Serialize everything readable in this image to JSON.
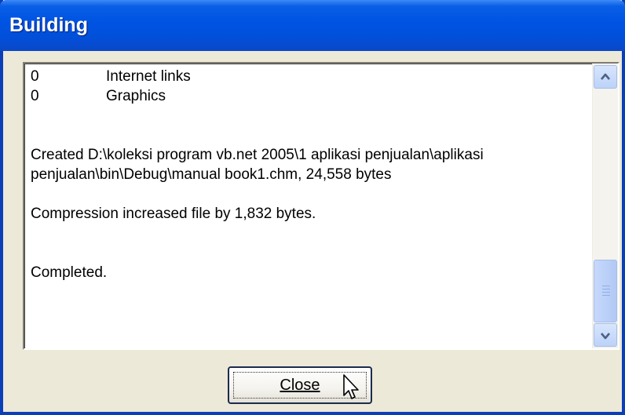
{
  "window": {
    "title": "Building"
  },
  "log": {
    "stats": [
      {
        "count": "0",
        "label": "Internet links"
      },
      {
        "count": "0",
        "label": "Graphics"
      }
    ],
    "created_line1": "Created D:\\koleksi program vb.net 2005\\1 aplikasi penjualan\\aplikasi",
    "created_line2": "penjualan\\bin\\Debug\\manual book1.chm, 24,558 bytes",
    "compression": "Compression increased file by 1,832 bytes.",
    "status": "Completed."
  },
  "scrollbar": {
    "up_icon": "chevron-up-icon",
    "down_icon": "chevron-down-icon"
  },
  "buttons": {
    "close_label": "Close"
  },
  "colors": {
    "titlebar": "#0054e3",
    "dialog_bg": "#ece9d8",
    "scroll_accent": "#4d6185"
  }
}
